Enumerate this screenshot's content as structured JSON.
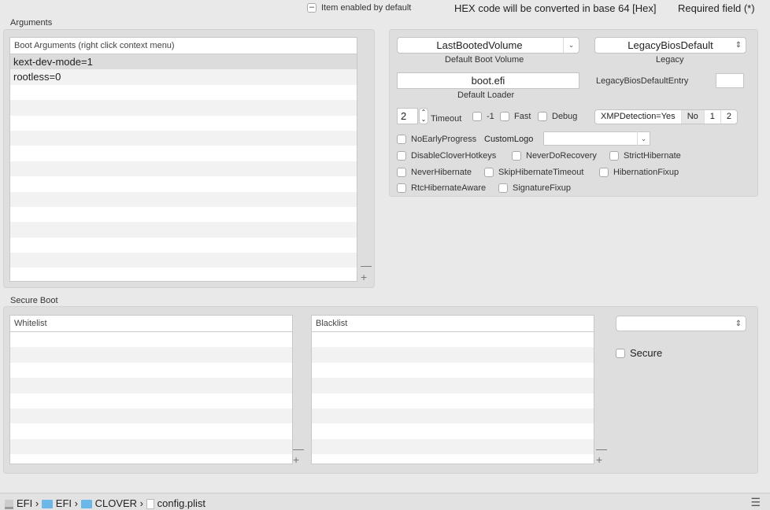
{
  "top": {
    "item_enabled": "Item enabled by default",
    "hex_note": "HEX code will be converted in base 64 [Hex]",
    "required": "Required field (*)"
  },
  "arguments": {
    "title": "Arguments",
    "table_header": "Boot Arguments (right click context menu)",
    "rows": [
      "kext-dev-mode=1",
      "rootless=0"
    ]
  },
  "boot": {
    "default_volume": "LastBootedVolume",
    "default_volume_label": "Default Boot Volume",
    "legacy": "LegacyBiosDefault",
    "legacy_label": "Legacy",
    "default_loader": "boot.efi",
    "default_loader_label": "Default Loader",
    "legacy_entry_label": "LegacyBiosDefaultEntry",
    "legacy_entry_value": "",
    "timeout": "2",
    "timeout_label": "Timeout",
    "minus1": "-1",
    "fast": "Fast",
    "debug": "Debug",
    "xmp": [
      "XMPDetection=Yes",
      "No",
      "1",
      "2"
    ],
    "custom_logo_label": "CustomLogo",
    "custom_logo_value": "",
    "checkboxes": [
      "NoEarlyProgress",
      "DisableCloverHotkeys",
      "NeverDoRecovery",
      "StrictHibernate",
      "NeverHibernate",
      "SkipHibernateTimeout",
      "HibernationFixup",
      "RtcHibernateAware",
      "SignatureFixup"
    ]
  },
  "secure_boot": {
    "title": "Secure Boot",
    "whitelist": "Whitelist",
    "blacklist": "Blacklist",
    "policy_value": "",
    "secure": "Secure"
  },
  "pathbar": [
    "EFI",
    "EFI",
    "CLOVER",
    "config.plist"
  ]
}
